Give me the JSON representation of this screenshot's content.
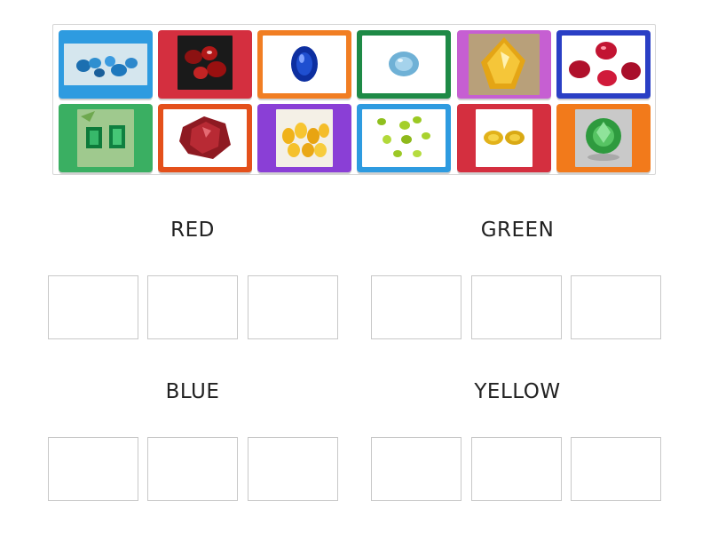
{
  "tiles": [
    {
      "gem": "blue-topaz-icon",
      "frame": "#2e9be0"
    },
    {
      "gem": "red-garnet-icon",
      "frame": "#d42f3f"
    },
    {
      "gem": "sapphire-icon",
      "frame": "#f17e23"
    },
    {
      "gem": "aquamarine-icon",
      "frame": "#1e8a46"
    },
    {
      "gem": "citrine-icon",
      "frame": "#c65fd2"
    },
    {
      "gem": "ruby-icon",
      "frame": "#2a3fc5"
    },
    {
      "gem": "emerald-icon",
      "frame": "#3aaf62"
    },
    {
      "gem": "red-beryl-icon",
      "frame": "#e4501b"
    },
    {
      "gem": "yellow-citrine-pile-icon",
      "frame": "#8a3fd6"
    },
    {
      "gem": "peridot-icon",
      "frame": "#2e9be0"
    },
    {
      "gem": "yellow-sapphire-icon",
      "frame": "#d42f3f"
    },
    {
      "gem": "green-garnet-icon",
      "frame": "#f27a1b"
    }
  ],
  "categories": [
    {
      "label": "RED"
    },
    {
      "label": "GREEN"
    },
    {
      "label": "BLUE"
    },
    {
      "label": "YELLOW"
    }
  ]
}
